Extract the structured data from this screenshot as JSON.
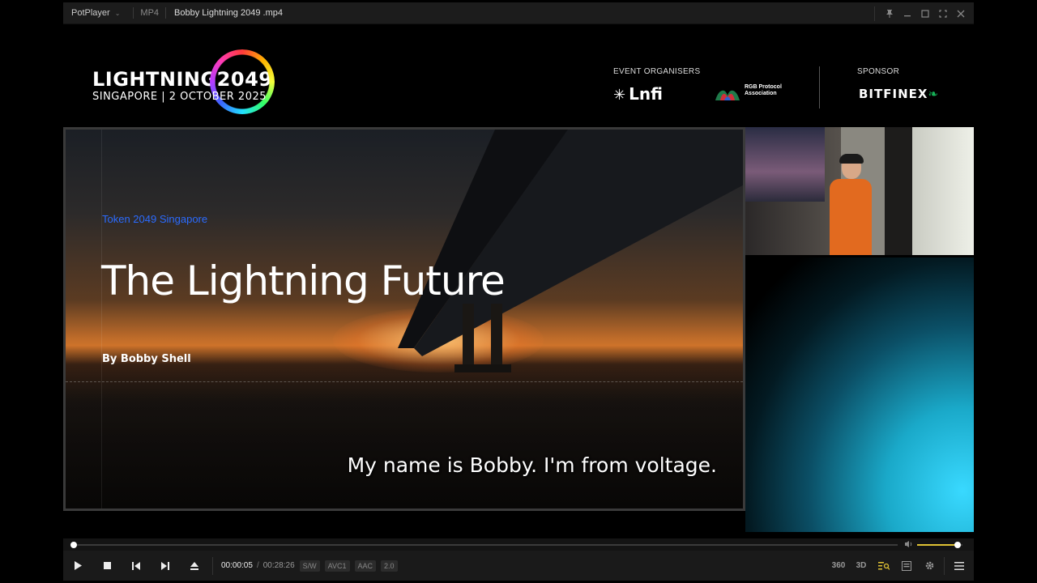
{
  "player": {
    "app_name": "PotPlayer",
    "format": "MP4",
    "file_title": "Bobby Lightning 2049 .mp4"
  },
  "event": {
    "logo_title": "LIGHTNING2049",
    "logo_subtitle": "SINGAPORE  |  2 OCTOBER 2025",
    "organisers_label": "EVENT ORGANISERS",
    "organiser_1": "Lnfi",
    "organiser_2": "RGB Protocol Association",
    "sponsor_label": "SPONSOR",
    "sponsor": "BITFINEX"
  },
  "slide": {
    "kicker": "Token 2049 Singapore",
    "title": "The Lightning Future",
    "author": "By Bobby Shell"
  },
  "subtitle": "My name is Bobby. I'm from voltage.",
  "playback": {
    "current_time": "00:00:05",
    "separator": "/",
    "total_time": "00:28:26",
    "progress_fraction": 0.003,
    "volume_fraction": 0.9,
    "badges": [
      "S/W",
      "AVC1",
      "AAC",
      "2.0"
    ]
  },
  "right_controls": [
    "360",
    "3D"
  ],
  "colors": {
    "accent": "#e0c234",
    "slide_kicker": "#2b6bff",
    "bitfinex_leaf": "#16b157"
  }
}
